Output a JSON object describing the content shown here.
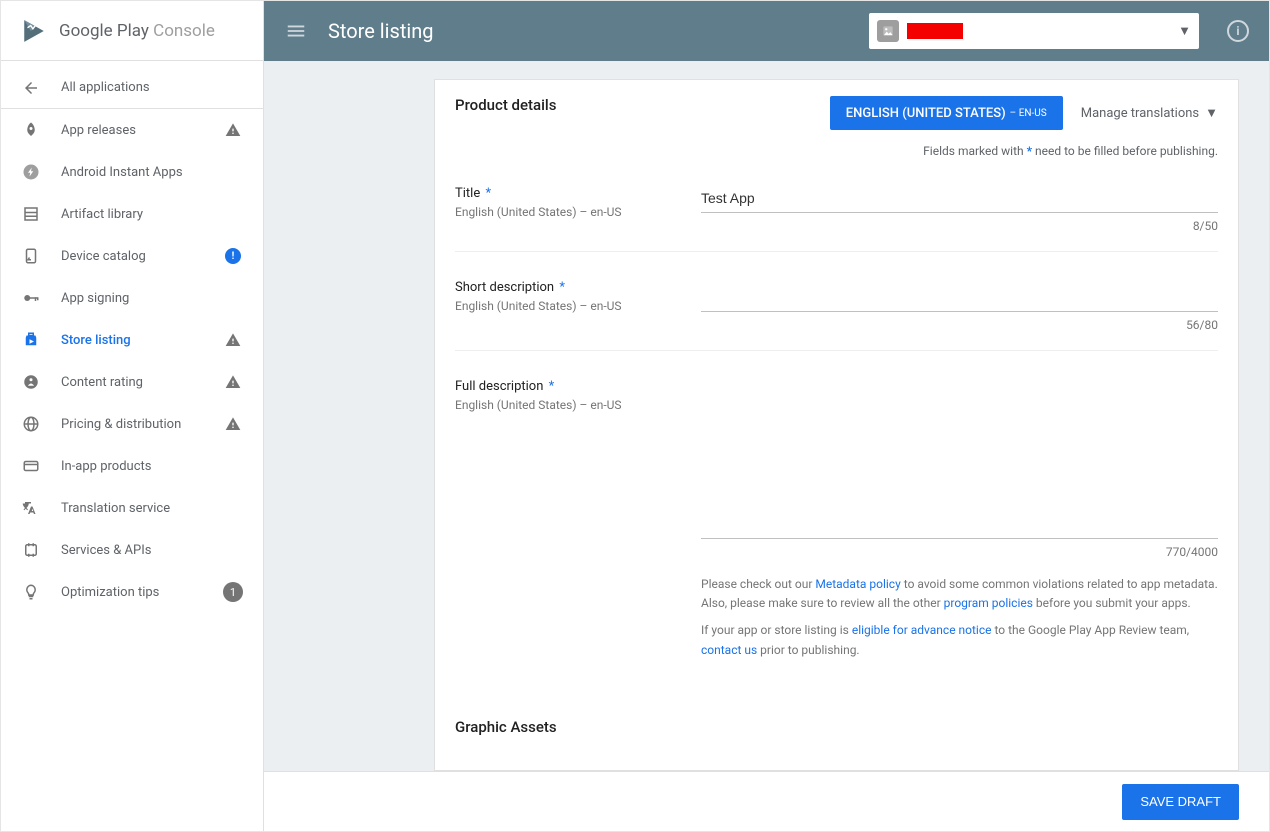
{
  "brand": {
    "text1": "Google Play",
    "text2": " Console"
  },
  "sidebar": {
    "items": [
      {
        "label": "All applications"
      },
      {
        "label": "App releases"
      },
      {
        "label": "Android Instant Apps"
      },
      {
        "label": "Artifact library"
      },
      {
        "label": "Device catalog"
      },
      {
        "label": "App signing"
      },
      {
        "label": "Store listing"
      },
      {
        "label": "Content rating"
      },
      {
        "label": "Pricing & distribution"
      },
      {
        "label": "In-app products"
      },
      {
        "label": "Translation service"
      },
      {
        "label": "Services & APIs"
      },
      {
        "label": "Optimization tips",
        "badge": "1"
      }
    ]
  },
  "topbar": {
    "page_title": "Store listing"
  },
  "product_details": {
    "heading": "Product details",
    "lang_main": "ENGLISH (UNITED STATES)",
    "lang_sub": "– EN-US",
    "manage": "Manage translations",
    "required_note_pre": "Fields marked with ",
    "required_note_star": "*",
    "required_note_post": " need to be filled before publishing.",
    "title": {
      "label": "Title",
      "sublabel": "English (United States) – en-US",
      "value": "Test App",
      "counter": "8/50"
    },
    "short_desc": {
      "label": "Short description",
      "sublabel": "English (United States) – en-US",
      "counter": "56/80"
    },
    "full_desc": {
      "label": "Full description",
      "sublabel": "English (United States) – en-US",
      "counter": "770/4000"
    },
    "policy": {
      "p1a": "Please check out our ",
      "link1": "Metadata policy",
      "p1b": " to avoid some common violations related to app metadata. Also, please make sure to review all the other ",
      "link2": "program policies",
      "p1c": " before you submit your apps.",
      "p2a": "If your app or store listing is ",
      "link3": "eligible for advance notice",
      "p2b": " to the Google Play App Review team, ",
      "link4": "contact us",
      "p2c": " prior to publishing."
    }
  },
  "graphic_assets": {
    "heading": "Graphic Assets"
  },
  "footer": {
    "save": "SAVE DRAFT"
  }
}
